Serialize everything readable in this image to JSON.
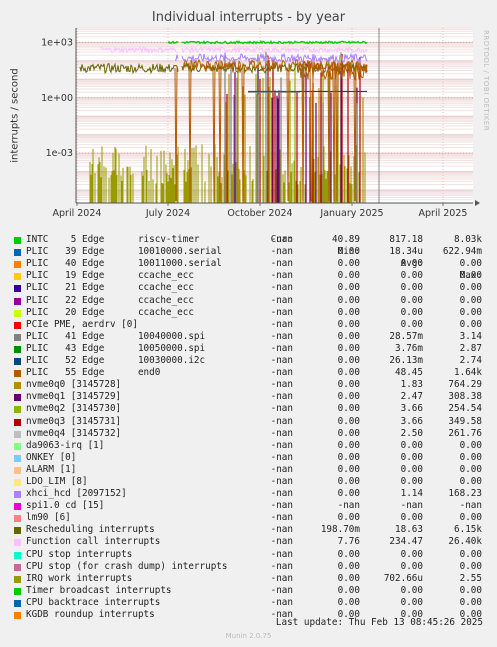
{
  "chart_data": {
    "type": "line",
    "title": "Individual interrupts - by year",
    "ylabel": "interrupts / second",
    "yscale": "log",
    "ylim": [
      2e-06,
      6000
    ],
    "y_ticks": [
      {
        "value": 1000,
        "label": "1e+03"
      },
      {
        "value": 1,
        "label": "1e+00"
      },
      {
        "value": 0.001,
        "label": "1e-03"
      }
    ],
    "x_ticks": [
      "April 2024",
      "July 2024",
      "October 2024",
      "January 2025",
      "April 2025"
    ],
    "side_label": "RRDTOOL / TOBI OETIKER",
    "series": [
      {
        "name": "INTC    5 Edge      riscv-timer",
        "color": "#00cc00",
        "cur": "-nan",
        "min": "40.89",
        "avg": "817.18",
        "max": "8.03k"
      },
      {
        "name": "PLIC   39 Edge      10010000.serial",
        "color": "#0066b3",
        "cur": "-nan",
        "min": "0.00",
        "avg": "18.34u",
        "max": "622.94m"
      },
      {
        "name": "PLIC   40 Edge      10011000.serial",
        "color": "#ff8000",
        "cur": "-nan",
        "min": "0.00",
        "avg": "0.00",
        "max": "0.00"
      },
      {
        "name": "PLIC   19 Edge      ccache_ecc",
        "color": "#ffcc00",
        "cur": "-nan",
        "min": "0.00",
        "avg": "0.00",
        "max": "0.00"
      },
      {
        "name": "PLIC   21 Edge      ccache_ecc",
        "color": "#330099",
        "cur": "-nan",
        "min": "0.00",
        "avg": "0.00",
        "max": "0.00"
      },
      {
        "name": "PLIC   22 Edge      ccache_ecc",
        "color": "#990099",
        "cur": "-nan",
        "min": "0.00",
        "avg": "0.00",
        "max": "0.00"
      },
      {
        "name": "PLIC   20 Edge      ccache_ecc",
        "color": "#ccff00",
        "cur": "-nan",
        "min": "0.00",
        "avg": "0.00",
        "max": "0.00"
      },
      {
        "name": "PCIe PME, aerdrv [0]",
        "color": "#ff0000",
        "cur": "-nan",
        "min": "0.00",
        "avg": "0.00",
        "max": "0.00"
      },
      {
        "name": "PLIC   41 Edge      10040000.spi",
        "color": "#808080",
        "cur": "-nan",
        "min": "0.00",
        "avg": "28.57m",
        "max": "3.14"
      },
      {
        "name": "PLIC   43 Edge      10050000.spi",
        "color": "#008f00",
        "cur": "-nan",
        "min": "0.00",
        "avg": "3.76m",
        "max": "2.87"
      },
      {
        "name": "PLIC   52 Edge      10030000.i2c",
        "color": "#00487d",
        "cur": "-nan",
        "min": "0.00",
        "avg": "26.13m",
        "max": "2.74"
      },
      {
        "name": "PLIC   55 Edge      end0",
        "color": "#b35a00",
        "cur": "-nan",
        "min": "0.00",
        "avg": "48.45",
        "max": "1.64k"
      },
      {
        "name": "nvme0q0 [3145728]",
        "color": "#b38f00",
        "cur": "-nan",
        "min": "0.00",
        "avg": "1.83",
        "max": "764.29"
      },
      {
        "name": "nvme0q1 [3145729]",
        "color": "#6b006b",
        "cur": "-nan",
        "min": "0.00",
        "avg": "2.47",
        "max": "308.38"
      },
      {
        "name": "nvme0q2 [3145730]",
        "color": "#8fb300",
        "cur": "-nan",
        "min": "0.00",
        "avg": "3.66",
        "max": "254.54"
      },
      {
        "name": "nvme0q3 [3145731]",
        "color": "#b30000",
        "cur": "-nan",
        "min": "0.00",
        "avg": "3.66",
        "max": "349.58"
      },
      {
        "name": "nvme0q4 [3145732]",
        "color": "#bebebe",
        "cur": "-nan",
        "min": "0.00",
        "avg": "2.50",
        "max": "261.76"
      },
      {
        "name": "da9063-irq [1]",
        "color": "#80ff80",
        "cur": "-nan",
        "min": "0.00",
        "avg": "0.00",
        "max": "0.00"
      },
      {
        "name": "ONKEY [0]",
        "color": "#80c9ff",
        "cur": "-nan",
        "min": "0.00",
        "avg": "0.00",
        "max": "0.00"
      },
      {
        "name": "ALARM [1]",
        "color": "#ffc080",
        "cur": "-nan",
        "min": "0.00",
        "avg": "0.00",
        "max": "0.00"
      },
      {
        "name": "LDO_LIM [8]",
        "color": "#ffe680",
        "cur": "-nan",
        "min": "0.00",
        "avg": "0.00",
        "max": "0.00"
      },
      {
        "name": "xhci_hcd [2097152]",
        "color": "#aa80ff",
        "cur": "-nan",
        "min": "0.00",
        "avg": "1.14",
        "max": "168.23"
      },
      {
        "name": "spi1.0 cd [15]",
        "color": "#ee00cc",
        "cur": "-nan",
        "min": "-nan",
        "avg": "-nan",
        "max": "-nan"
      },
      {
        "name": "lm90 [6]",
        "color": "#ff8080",
        "cur": "-nan",
        "min": "0.00",
        "avg": "0.00",
        "max": "0.00"
      },
      {
        "name": "Rescheduling interrupts",
        "color": "#666600",
        "cur": "-nan",
        "min": "198.70m",
        "avg": "18.63",
        "max": "6.15k"
      },
      {
        "name": "Function call interrupts",
        "color": "#ffbfff",
        "cur": "-nan",
        "min": "7.76",
        "avg": "234.47",
        "max": "26.40k"
      },
      {
        "name": "CPU stop interrupts",
        "color": "#00ffcc",
        "cur": "-nan",
        "min": "0.00",
        "avg": "0.00",
        "max": "0.00"
      },
      {
        "name": "CPU stop (for crash dump) interrupts",
        "color": "#cc6699",
        "cur": "-nan",
        "min": "0.00",
        "avg": "0.00",
        "max": "0.00"
      },
      {
        "name": "IRQ work interrupts",
        "color": "#999900",
        "cur": "-nan",
        "min": "0.00",
        "avg": "702.66u",
        "max": "2.55"
      },
      {
        "name": "Timer broadcast interrupts",
        "color": "#00cc00",
        "cur": "-nan",
        "min": "0.00",
        "avg": "0.00",
        "max": "0.00"
      },
      {
        "name": "CPU backtrace interrupts",
        "color": "#0066b3",
        "cur": "-nan",
        "min": "0.00",
        "avg": "0.00",
        "max": "0.00"
      },
      {
        "name": "KGDB roundup interrupts",
        "color": "#ff8000",
        "cur": "-nan",
        "min": "0.00",
        "avg": "0.00",
        "max": "0.00"
      }
    ]
  },
  "legend_headers": {
    "cur": "Cur:",
    "min": "Min:",
    "avg": "Avg:",
    "max": "Max:"
  },
  "footer": {
    "last_update": "Last update: Thu Feb 13 08:45:26 2025",
    "munin": "Munin 2.0.75"
  }
}
